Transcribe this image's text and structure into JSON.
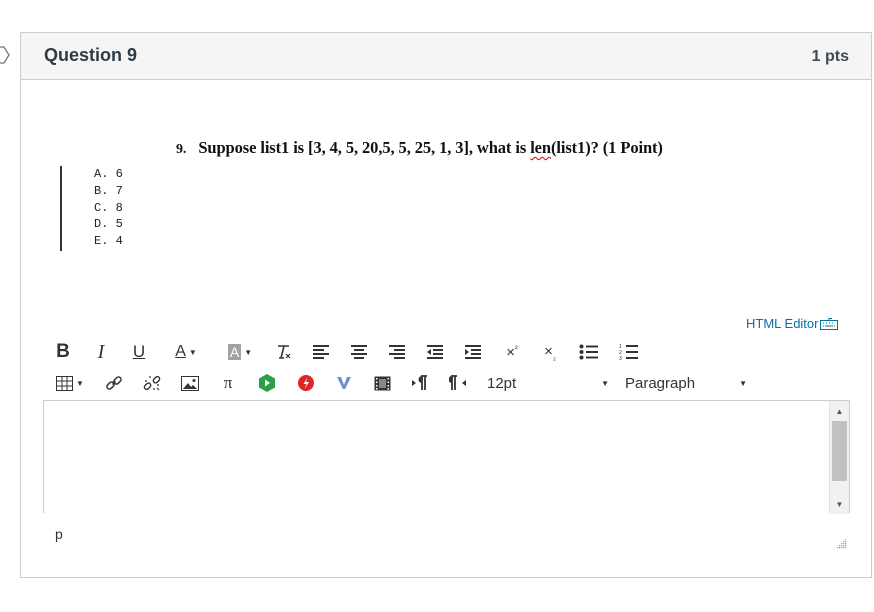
{
  "question": {
    "title": "Question 9",
    "points": "1 pts",
    "number": "9.",
    "text_pre": "Suppose list1 is [3, 4, 5, 20,5, 5, 25, 1, 3], what is ",
    "text_flag": "len",
    "text_post": "(list1)? (1 Point)",
    "choices": [
      "A. 6",
      "B. 7",
      "C. 8",
      "D. 5",
      "E. 4"
    ]
  },
  "editor": {
    "html_editor_label": "HTML Editor",
    "font_size": "12pt",
    "block_format": "Paragraph",
    "status_path": "p",
    "content": ""
  },
  "toolbar": {
    "bold": "B",
    "italic": "I",
    "underline": "U",
    "text_color": "A",
    "bg_color": "A",
    "pi": "π"
  },
  "colors": {
    "link": "#0770a3",
    "border": "#c7cdd1",
    "header_bg": "#f5f5f5"
  }
}
